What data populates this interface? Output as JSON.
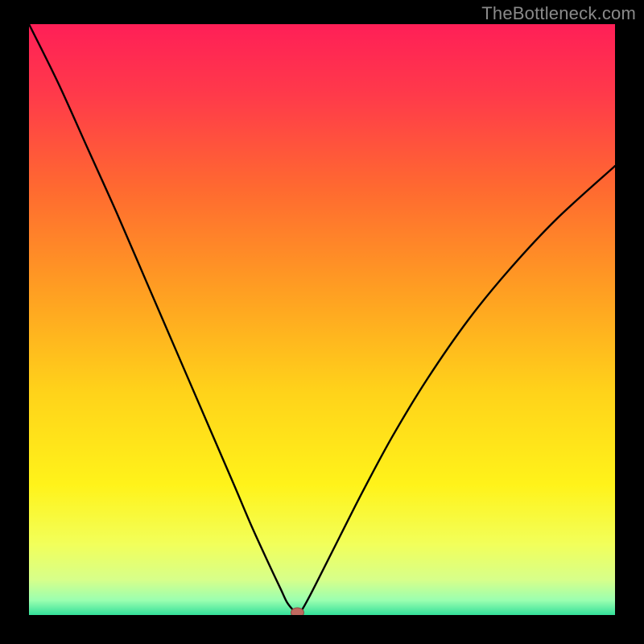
{
  "watermark": "TheBottleneck.com",
  "colors": {
    "black": "#000000",
    "curve": "#000000",
    "marker_fill": "#c0695f",
    "marker_stroke": "#8a4a42",
    "gradient_stops": [
      {
        "offset": 0.0,
        "color": "#ff1f57"
      },
      {
        "offset": 0.12,
        "color": "#ff3a4a"
      },
      {
        "offset": 0.28,
        "color": "#ff6a30"
      },
      {
        "offset": 0.45,
        "color": "#ff9e22"
      },
      {
        "offset": 0.62,
        "color": "#ffd21a"
      },
      {
        "offset": 0.78,
        "color": "#fff31a"
      },
      {
        "offset": 0.88,
        "color": "#f2ff5a"
      },
      {
        "offset": 0.94,
        "color": "#d7ff8a"
      },
      {
        "offset": 0.975,
        "color": "#9bffb0"
      },
      {
        "offset": 1.0,
        "color": "#33e09a"
      }
    ]
  },
  "chart_data": {
    "type": "line",
    "title": "",
    "xlabel": "",
    "ylabel": "",
    "xlim": [
      0,
      100
    ],
    "ylim": [
      0,
      100
    ],
    "grid": false,
    "legend": false,
    "marker": {
      "x": 45.8,
      "y": 0
    },
    "series": [
      {
        "name": "bottleneck-curve",
        "x": [
          0,
          5,
          10,
          15,
          20,
          25,
          30,
          35,
          38,
          41,
          43,
          44,
          45,
          45.8,
          46.6,
          48,
          50,
          53,
          57,
          62,
          68,
          75,
          82,
          90,
          100
        ],
        "y": [
          100,
          90,
          79,
          68,
          56.5,
          45,
          33.5,
          22,
          15,
          8.5,
          4.3,
          2.2,
          0.9,
          0,
          0.9,
          3.4,
          7.3,
          13.2,
          21,
          30.2,
          40,
          50,
          58.5,
          67,
          76
        ]
      }
    ]
  }
}
